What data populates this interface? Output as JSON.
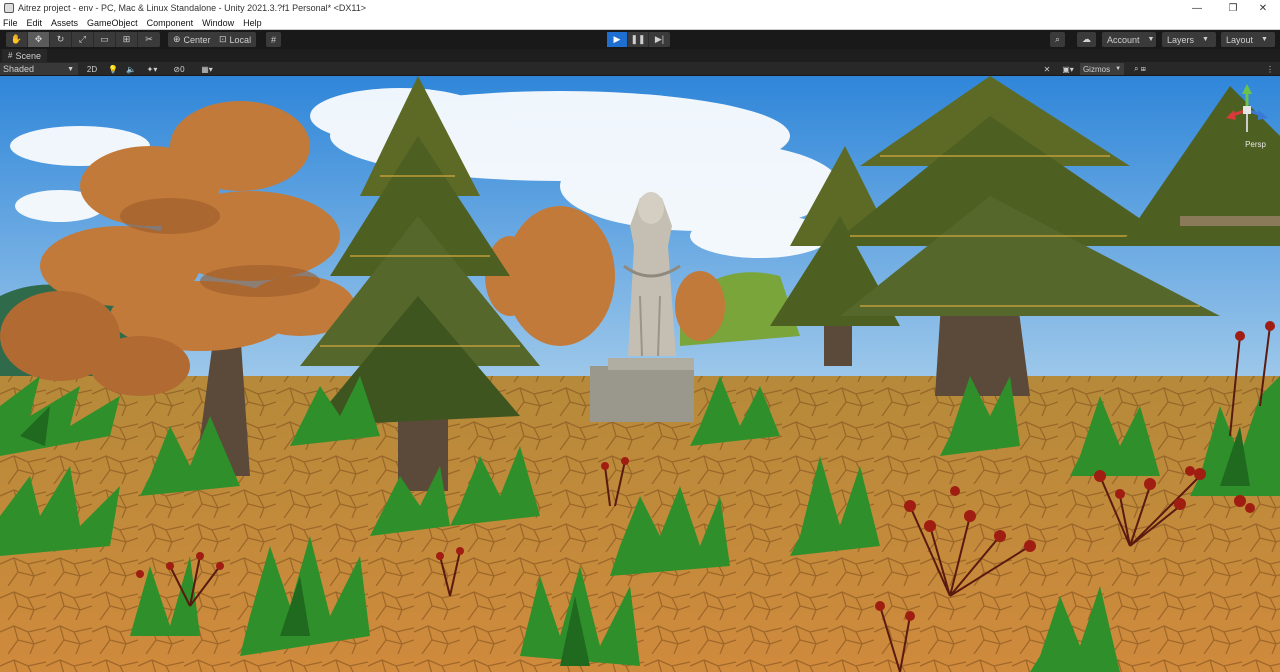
{
  "window": {
    "title": "Aitrez project - env - PC, Mac & Linux Standalone - Unity 2021.3.?f1 Personal* <DX11>",
    "minimize_glyph": "—",
    "maximize_glyph": "❐",
    "close_glyph": "✕"
  },
  "menu": [
    "File",
    "Edit",
    "Assets",
    "GameObject",
    "Component",
    "Window",
    "Help"
  ],
  "toolbar": {
    "pivot_label": "Center",
    "space_label": "Local",
    "account_label": "Account",
    "layers_label": "Layers",
    "layout_label": "Layout"
  },
  "scene_tab": {
    "label": "Scene"
  },
  "scene_toolbar": {
    "shading_mode": "Shaded",
    "mode_2d": "2D",
    "hidden_count": "0",
    "gizmos_label": "Gizmos"
  },
  "viewport": {
    "gizmo_label": "Persp"
  },
  "colors": {
    "play_active": "#1f6fd0",
    "sky": "#3f8fd6",
    "ground": "#c98a3c",
    "grass": "#2f8f2a",
    "autumn_foliage": "#c27a3a",
    "pine": "#5a6a2a",
    "statue": "#b8b2a4",
    "flowers": "#8e1b12"
  },
  "icons": {
    "hand-tool": "hand-icon",
    "move-tool": "move-icon",
    "rotate-tool": "rotate-icon",
    "scale-tool": "scale-icon",
    "rect-tool": "rect-icon",
    "transform-tool": "transform-icon",
    "custom-tool": "custom-tool-icon",
    "play": "play-icon",
    "pause": "pause-icon",
    "step": "step-icon",
    "search": "search-icon",
    "cloud": "cloud-icon"
  }
}
